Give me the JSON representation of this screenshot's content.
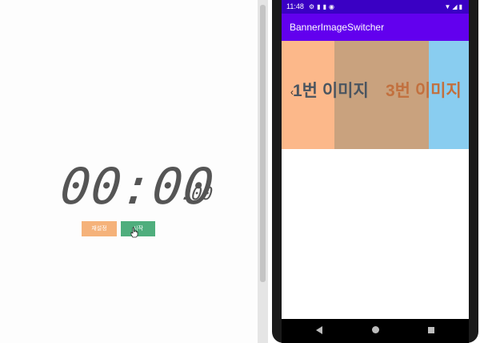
{
  "stopwatch": {
    "time_main": "00:00",
    "time_cs": ".00",
    "reset_label": "재설정",
    "start_label": "시작"
  },
  "phone": {
    "status_time": "11:48",
    "app_title": "BannerImageSwitcher",
    "banner": {
      "slide_1_text": "1번 이미지",
      "slide_3_text": "3번 이미지",
      "arrow": "‹"
    }
  },
  "colors": {
    "app_bar": "#6200ee",
    "status_bar": "#3a00c4",
    "reset_button": "#f5b27a",
    "start_button": "#4fae7d"
  }
}
